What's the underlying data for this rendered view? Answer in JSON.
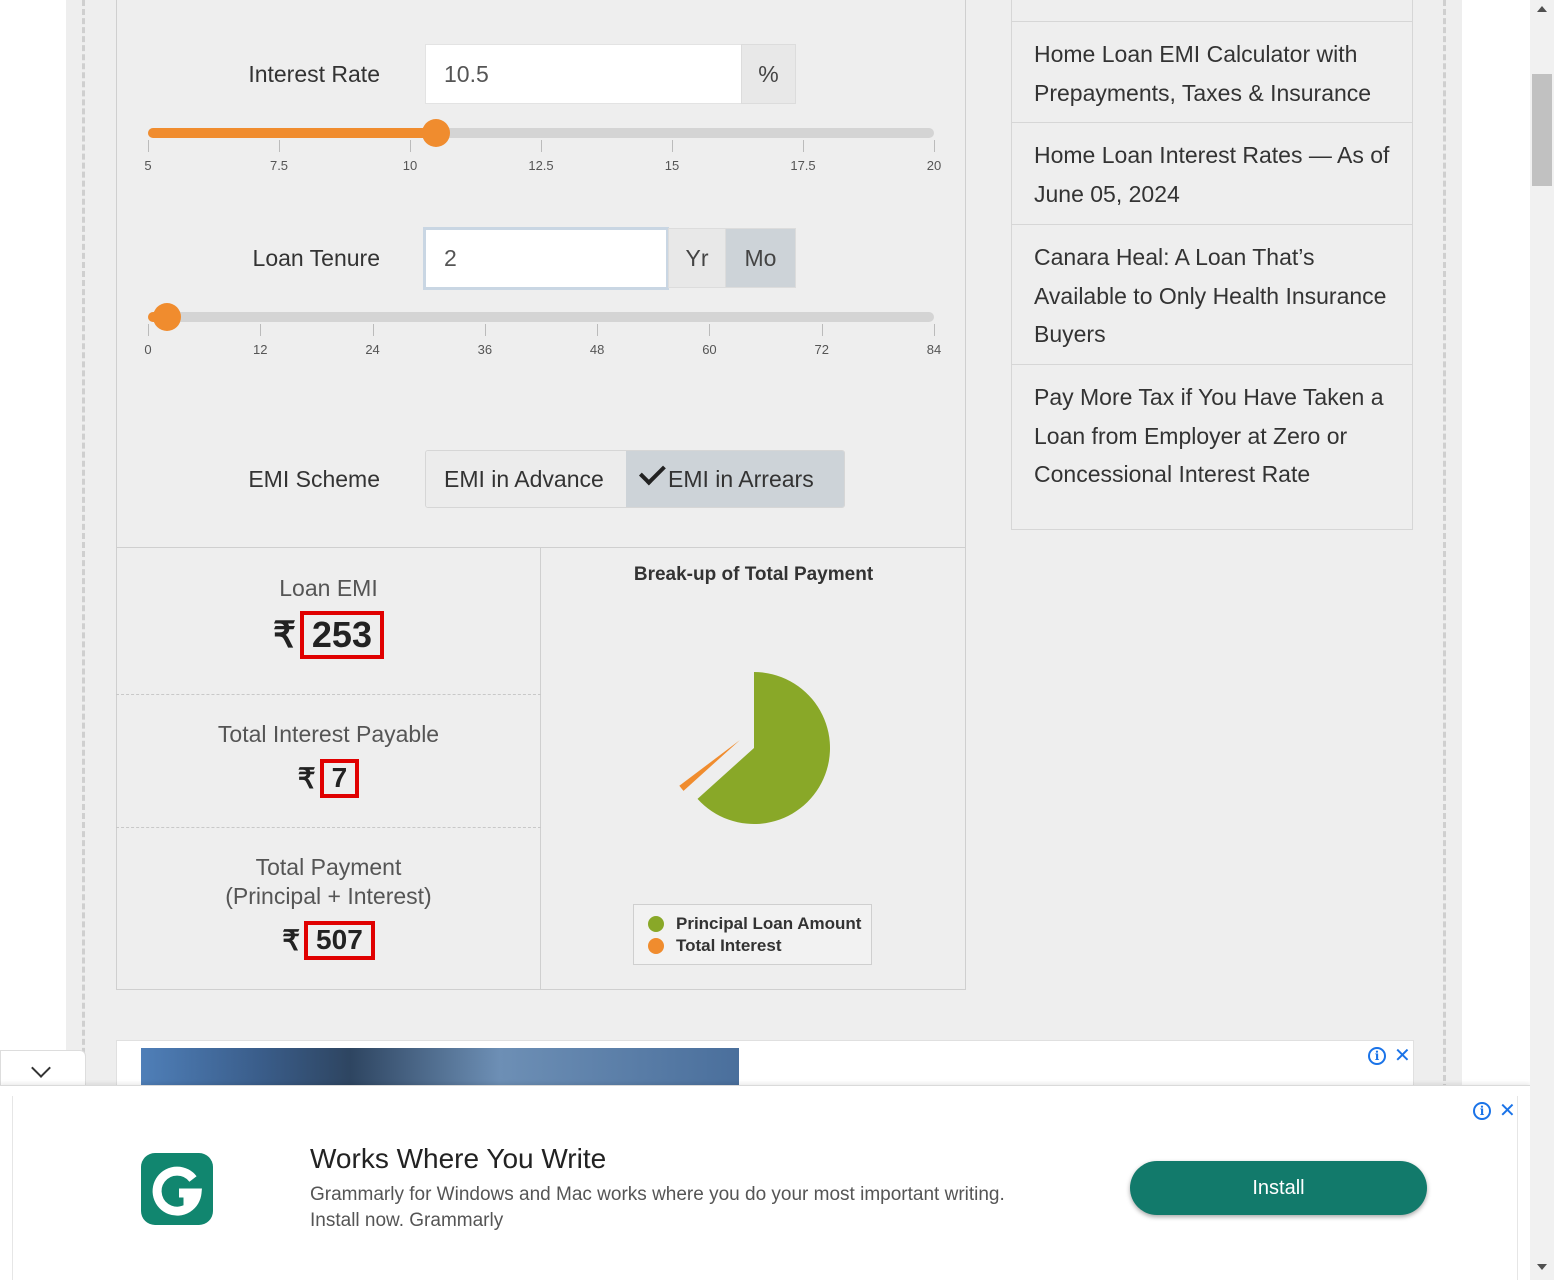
{
  "calculator": {
    "interest_rate": {
      "label": "Interest Rate",
      "value": "10.5",
      "unit": "%",
      "slider_min": 5,
      "slider_max": 20,
      "slider_value": 10.5,
      "ticks": [
        "5",
        "7.5",
        "10",
        "12.5",
        "15",
        "17.5",
        "20"
      ]
    },
    "loan_tenure": {
      "label": "Loan Tenure",
      "value": "2",
      "unit_year": "Yr",
      "unit_month": "Mo",
      "selected_unit": "Mo",
      "slider_min": 0,
      "slider_max": 84,
      "slider_value": 2,
      "ticks": [
        "0",
        "12",
        "24",
        "36",
        "48",
        "60",
        "72",
        "84"
      ]
    },
    "emi_scheme": {
      "label": "EMI Scheme",
      "option_advance": "EMI in Advance",
      "option_arrears": "EMI in Arrears",
      "selected": "EMI in Arrears"
    }
  },
  "results": {
    "currency": "₹",
    "loan_emi_label": "Loan EMI",
    "loan_emi_value": "253",
    "total_interest_label": "Total Interest Payable",
    "total_interest_value": "7",
    "total_payment_label_line1": "Total Payment",
    "total_payment_label_line2": "(Principal + Interest)",
    "total_payment_value": "507"
  },
  "chart_data": {
    "type": "pie",
    "title": "Break-up of Total Payment",
    "categories": [
      "Principal Loan Amount",
      "Total Interest"
    ],
    "values": [
      500,
      7
    ],
    "colors": [
      "#89a828",
      "#f08c2e"
    ],
    "legend_position": "bottom"
  },
  "sidebar": {
    "items": [
      "Home Loan EMI Calculator with Prepayments, Taxes & Insurance",
      "Home Loan Interest Rates — As of June 05, 2024",
      "Canara Heal: A Loan That’s Available to Only Health Insurance Buyers",
      "Pay More Tax if You Have Taken a Loan from Employer at Zero or Concessional Interest Rate"
    ]
  },
  "ad": {
    "headline": "Works Where You Write",
    "body": "Grammarly for Windows and Mac works where you do your most important writing. Install now. Grammarly",
    "cta": "Install",
    "info_glyph": "i",
    "close_glyph": "✕"
  },
  "colors": {
    "accent_orange": "#f08c2e",
    "principal_green": "#89a828",
    "highlight_red": "#e00000",
    "install_teal": "#127a6b"
  }
}
